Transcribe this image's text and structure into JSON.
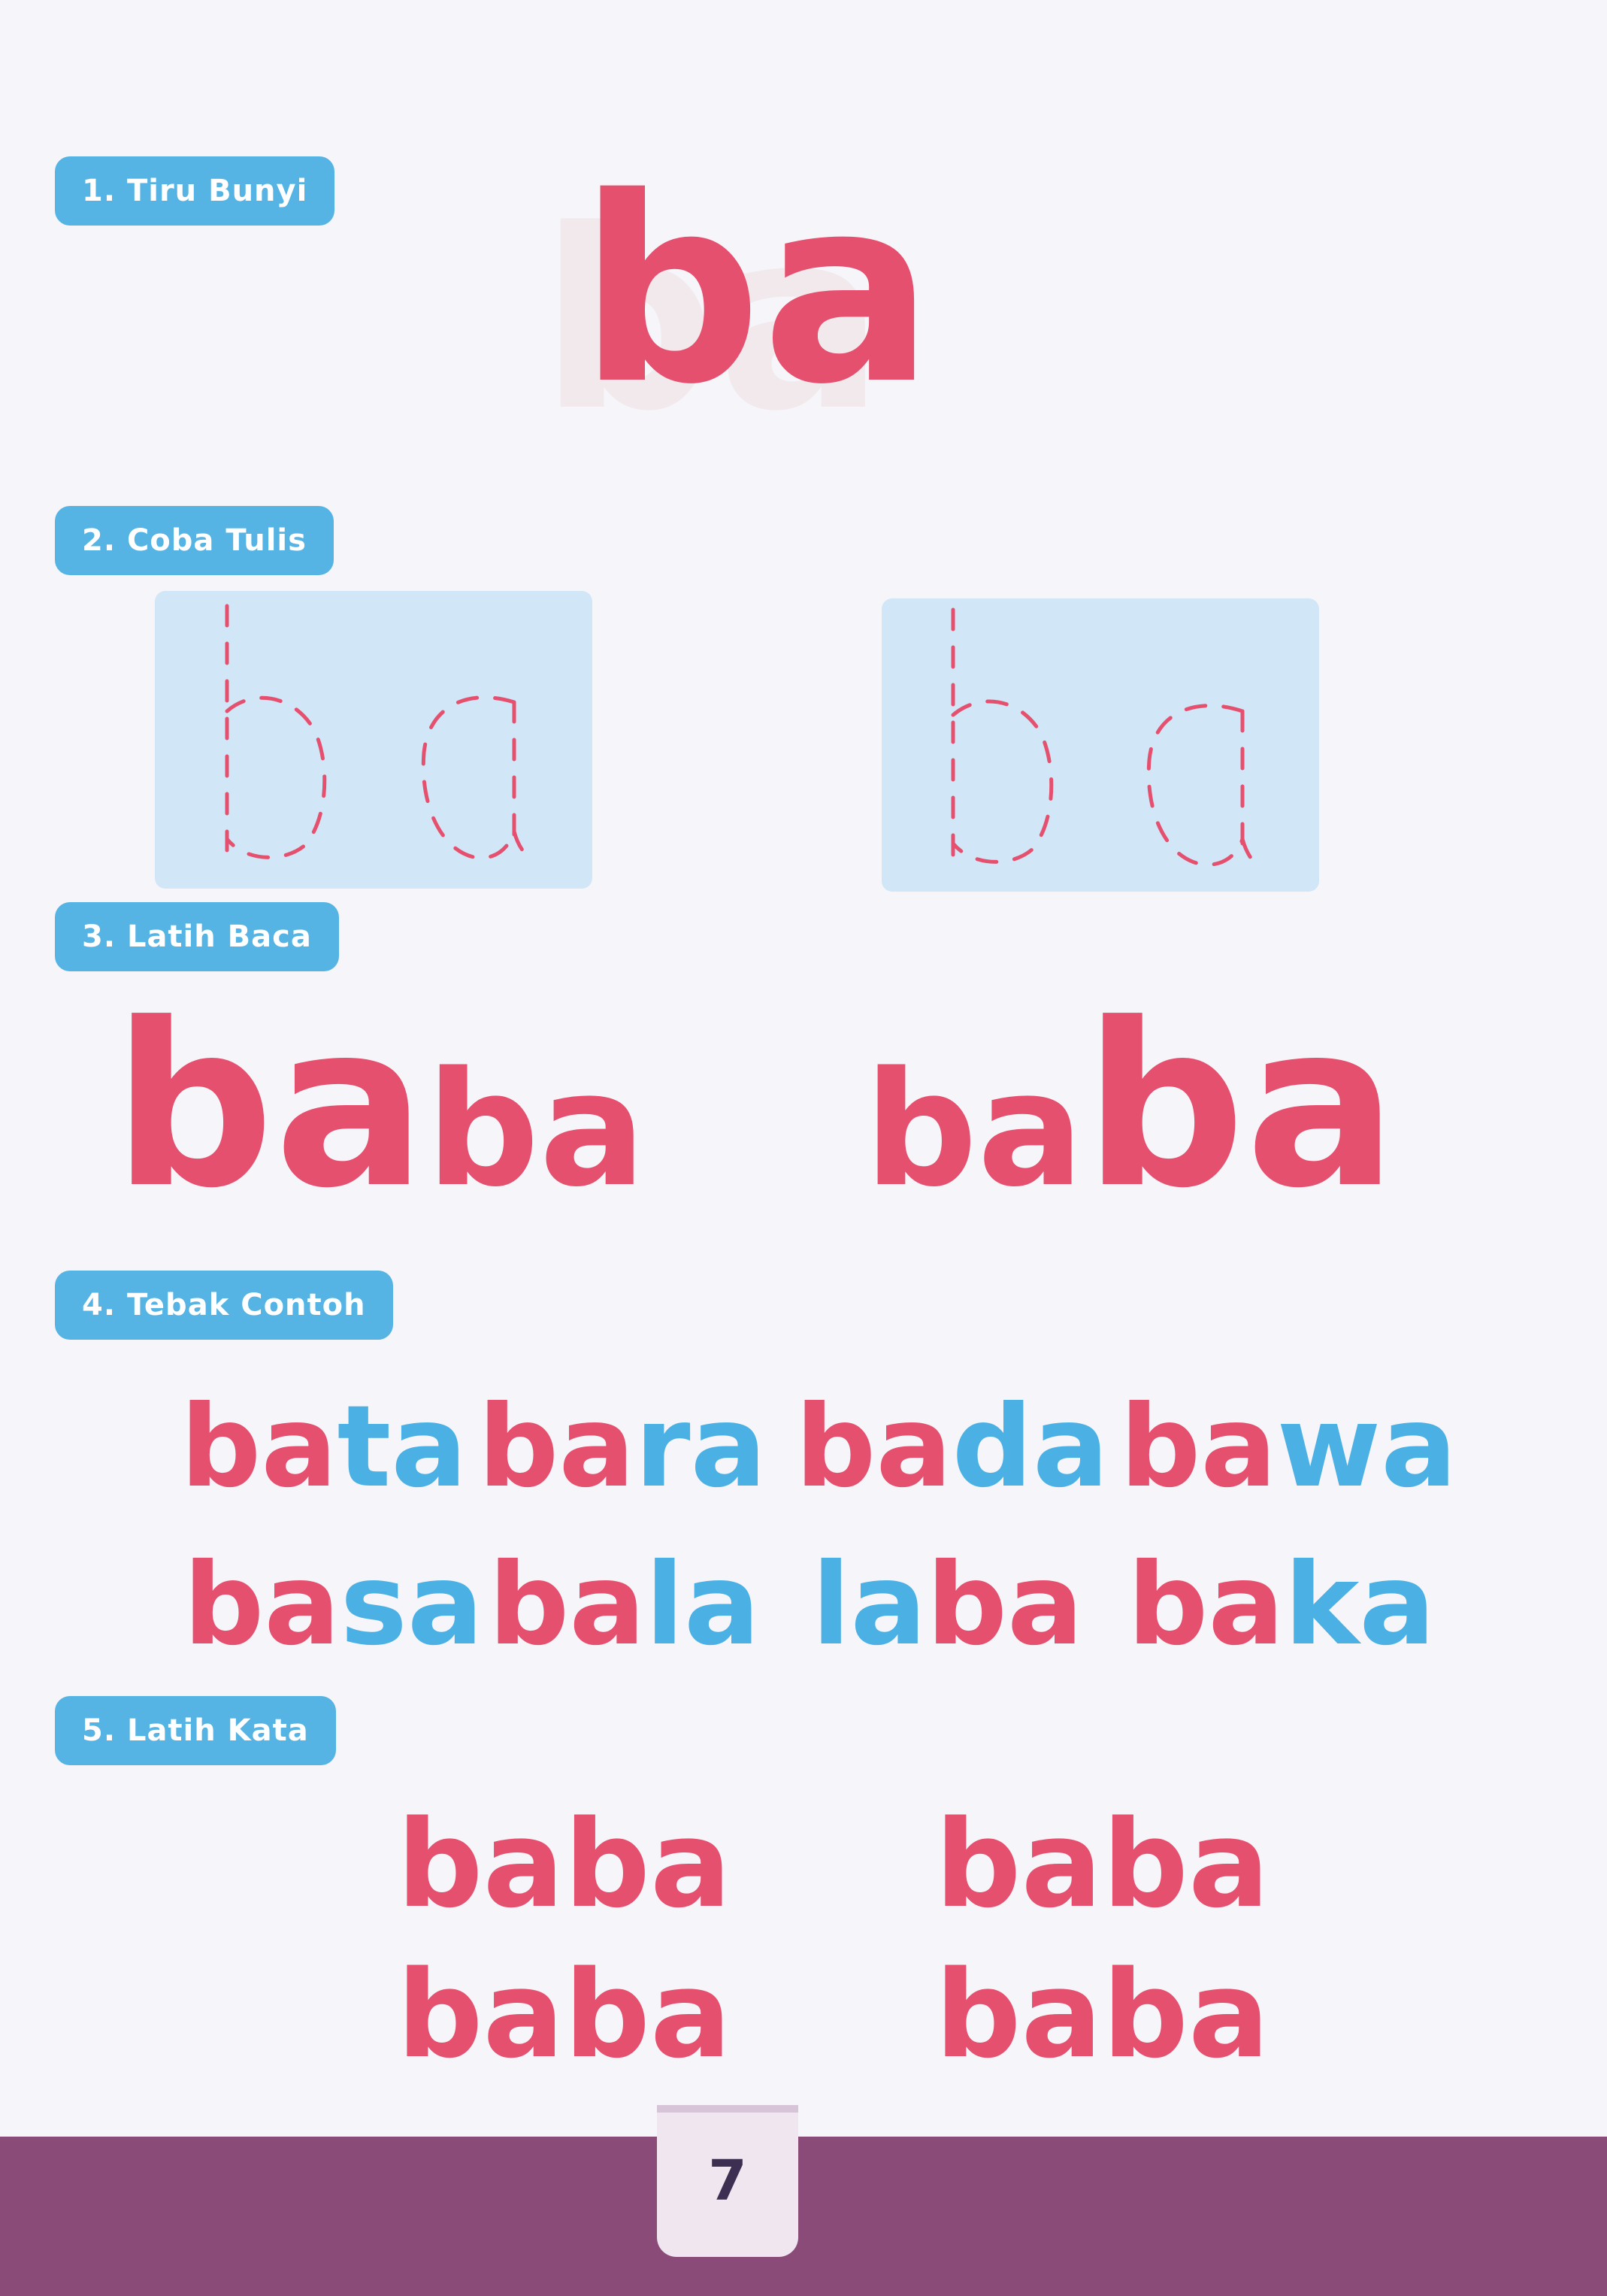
{
  "sections": {
    "s1": {
      "label": "1. Tiru Bunyi",
      "syllable": "ba"
    },
    "s2": {
      "label": "2. Coba Tulis",
      "trace_text": "ba"
    },
    "s3": {
      "label": "3. Latih Baca",
      "words": [
        {
          "big": "ba",
          "small": "ba"
        },
        {
          "small": "ba",
          "big": "ba"
        }
      ]
    },
    "s4": {
      "label": "4. Tebak Contoh",
      "words": [
        {
          "pink": "ba",
          "blue": "ta"
        },
        {
          "pink": "ba",
          "blue": "ra"
        },
        {
          "pink": "ba",
          "blue": "da"
        },
        {
          "pink": "ba",
          "blue": "wa"
        },
        {
          "pink": "ba",
          "blue": "sa"
        },
        {
          "pink": "ba",
          "blue": "la"
        },
        {
          "blue": "la",
          "pink": "ba"
        },
        {
          "pink": "ba",
          "blue": "ka"
        }
      ]
    },
    "s5": {
      "label": "5. Latih Kata",
      "words": [
        "baba",
        "baba",
        "baba",
        "baba"
      ]
    }
  },
  "page_number": "7",
  "colors": {
    "pink": "#e5506f",
    "blue": "#4bb1e4",
    "label_bg": "#55b4e3",
    "trace_bg": "#d1e6f6",
    "footer": "#8a4b78"
  }
}
